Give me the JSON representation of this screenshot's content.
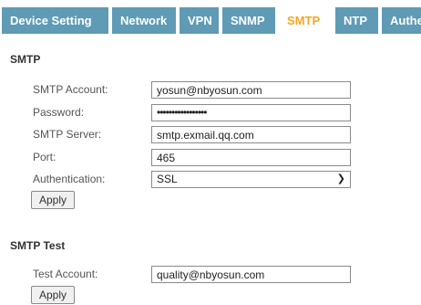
{
  "tabs": [
    {
      "label": "Device Setting",
      "active": false
    },
    {
      "label": "Network",
      "active": false
    },
    {
      "label": "VPN",
      "active": false
    },
    {
      "label": "SNMP",
      "active": false
    },
    {
      "label": "SMTP",
      "active": true
    },
    {
      "label": "NTP",
      "active": false
    },
    {
      "label": "Authe",
      "active": false
    }
  ],
  "smtp": {
    "title": "SMTP",
    "account_label": "SMTP Account:",
    "account_value": "yosun@nbyosun.com",
    "password_label": "Password:",
    "password_value": "•••••••••••••••••",
    "server_label": "SMTP Server:",
    "server_value": "smtp.exmail.qq.com",
    "port_label": "Port:",
    "port_value": "465",
    "auth_label": "Authentication:",
    "auth_value": "SSL",
    "apply_label": "Apply"
  },
  "smtp_test": {
    "title": "SMTP Test",
    "test_account_label": "Test Account:",
    "test_account_value": "quality@nbyosun.com",
    "apply_label": "Apply"
  },
  "colors": {
    "tab_bg": "#5f9bb5",
    "tab_active_text": "#f5a623"
  },
  "icons": {
    "auth_dropdown": "chevron-down-icon"
  }
}
